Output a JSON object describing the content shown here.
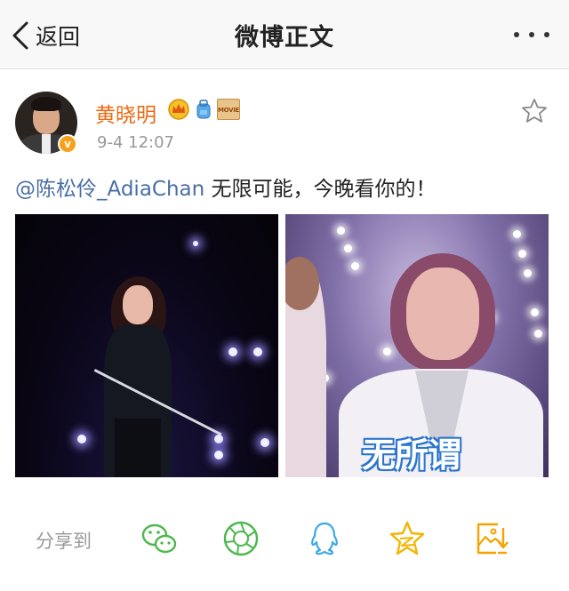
{
  "navbar": {
    "back_label": "返回",
    "title": "微博正文"
  },
  "post": {
    "author": {
      "name": "黄晓明",
      "verified_mark": "v",
      "badges": [
        "crown-badge-icon",
        "backpack-badge-icon",
        "movie-badge-icon"
      ],
      "movie_badge_text": "MOVIE"
    },
    "time": "9-4 12:07",
    "mention": "@陈松伶_AdiaChan",
    "text": " 无限可能，今晚看你的！",
    "images": [
      {
        "caption": ""
      },
      {
        "caption": "无所谓"
      }
    ]
  },
  "share": {
    "label": "分享到",
    "targets": [
      "wechat-icon",
      "moments-icon",
      "qq-icon",
      "qzone-icon",
      "save-image-icon"
    ]
  },
  "colors": {
    "author_name": "#e96b14",
    "mention": "#4a6fa5",
    "share_wechat": "#4cb84c",
    "share_moments": "#4cb84c",
    "share_qq": "#3ba8e8",
    "share_qzone": "#f4b400",
    "share_save": "#f4a300"
  }
}
